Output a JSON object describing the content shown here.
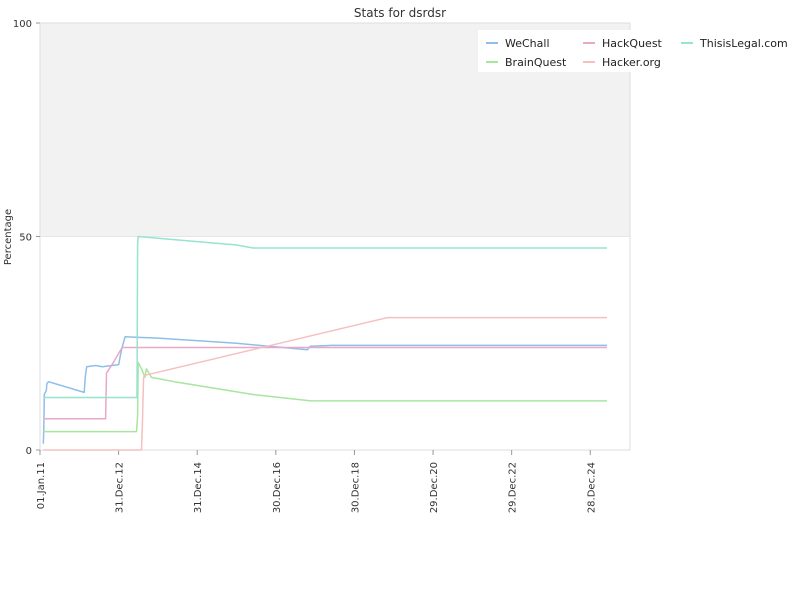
{
  "chart_data": {
    "type": "line",
    "title": "Stats for dsrdsr",
    "xlabel": "",
    "ylabel": "Percentage",
    "ylim": [
      0,
      100
    ],
    "yticks": [
      "0",
      "50",
      "100"
    ],
    "xlim": [
      "2011-01-01",
      "2026-01-01"
    ],
    "xticks": [
      {
        "date": "2011-01-01",
        "label": "01.Jan.11"
      },
      {
        "date": "2012-12-31",
        "label": "31.Dec.12"
      },
      {
        "date": "2014-12-31",
        "label": "31.Dec.14"
      },
      {
        "date": "2016-12-30",
        "label": "30.Dec.16"
      },
      {
        "date": "2018-12-30",
        "label": "30.Dec.18"
      },
      {
        "date": "2020-12-29",
        "label": "29.Dec.20"
      },
      {
        "date": "2022-12-29",
        "label": "29.Dec.22"
      },
      {
        "date": "2024-12-28",
        "label": "28.Dec.24"
      }
    ],
    "bands": [
      {
        "from": 50,
        "to": 100,
        "color": "#f2f2f2"
      }
    ],
    "grid": false,
    "legend_position": "top-right",
    "series": [
      {
        "name": "WeChall",
        "color": "#8fbfe8",
        "points": [
          [
            "2011-02-01",
            1.5
          ],
          [
            "2011-02-05",
            5
          ],
          [
            "2011-02-10",
            13
          ],
          [
            "2011-03-01",
            14
          ],
          [
            "2011-03-05",
            15.5
          ],
          [
            "2011-03-20",
            16
          ],
          [
            "2012-02-15",
            13.5
          ],
          [
            "2012-02-25",
            17
          ],
          [
            "2012-03-10",
            19.5
          ],
          [
            "2012-06-01",
            19.8
          ],
          [
            "2012-08-01",
            19.5
          ],
          [
            "2013-01-01",
            20
          ],
          [
            "2013-01-15",
            22
          ],
          [
            "2013-02-01",
            24
          ],
          [
            "2013-03-01",
            26.5
          ],
          [
            "2014-01-01",
            26.2
          ],
          [
            "2016-01-01",
            25
          ],
          [
            "2017-10-20",
            23.5
          ],
          [
            "2017-11-15",
            24.3
          ],
          [
            "2018-06-01",
            24.5
          ],
          [
            "2025-06-01",
            24.5
          ]
        ]
      },
      {
        "name": "BrainQuest",
        "color": "#a8e6a0",
        "points": [
          [
            "2011-02-01",
            4.3
          ],
          [
            "2013-06-15",
            4.3
          ],
          [
            "2013-06-25",
            8
          ],
          [
            "2013-07-01",
            20.5
          ],
          [
            "2013-08-01",
            19
          ],
          [
            "2013-09-01",
            17
          ],
          [
            "2013-09-15",
            19
          ],
          [
            "2013-11-01",
            17
          ],
          [
            "2014-06-01",
            16
          ],
          [
            "2016-06-01",
            13
          ],
          [
            "2017-11-20",
            11.5
          ],
          [
            "2025-06-01",
            11.5
          ]
        ]
      },
      {
        "name": "HackQuest",
        "color": "#eaa8c8",
        "points": [
          [
            "2011-02-01",
            7.3
          ],
          [
            "2012-09-01",
            7.3
          ],
          [
            "2012-09-10",
            18
          ],
          [
            "2012-11-01",
            20
          ],
          [
            "2013-02-01",
            24
          ],
          [
            "2016-06-01",
            24
          ],
          [
            "2025-06-01",
            24
          ]
        ]
      },
      {
        "name": "Hacker.org",
        "color": "#f5c0c0",
        "points": [
          [
            "2011-02-01",
            0
          ],
          [
            "2013-08-01",
            0
          ],
          [
            "2013-08-10",
            7
          ],
          [
            "2013-08-20",
            17
          ],
          [
            "2013-09-01",
            17.5
          ],
          [
            "2019-11-01",
            31
          ],
          [
            "2025-06-01",
            31
          ]
        ]
      },
      {
        "name": "ThisisLegal.com",
        "color": "#96e3d0",
        "points": [
          [
            "2011-02-01",
            12.3
          ],
          [
            "2013-06-20",
            12.3
          ],
          [
            "2013-06-25",
            48
          ],
          [
            "2013-07-01",
            50
          ],
          [
            "2014-01-01",
            49.6
          ],
          [
            "2016-01-01",
            48
          ],
          [
            "2016-06-01",
            47.3
          ],
          [
            "2025-06-01",
            47.3
          ]
        ]
      }
    ]
  }
}
